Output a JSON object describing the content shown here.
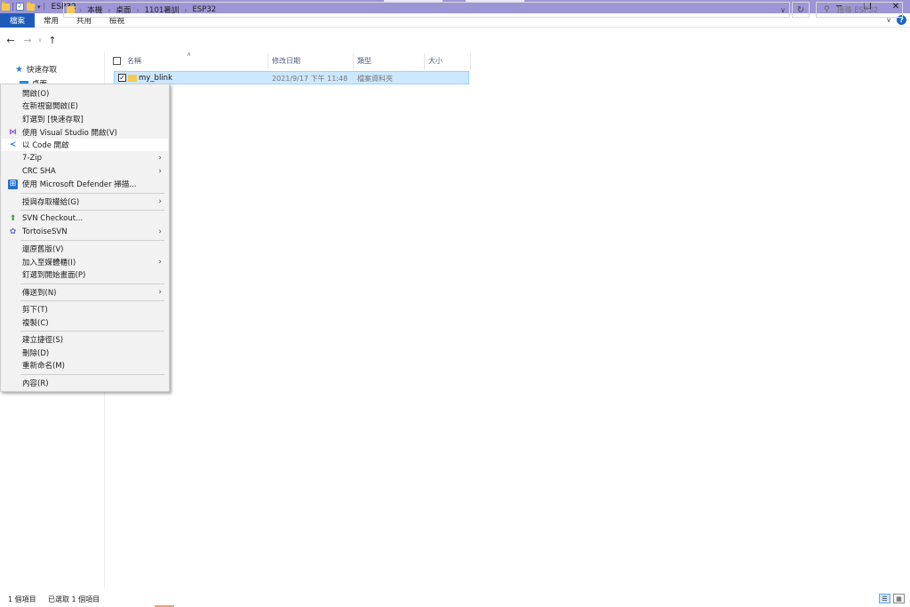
{
  "window": {
    "title": "ESP32",
    "controls": {
      "minimize": "─",
      "maximize": "❐",
      "close": "✕"
    }
  },
  "ribbon": {
    "tabs": [
      "檔案",
      "常用",
      "共用",
      "檢視"
    ],
    "collapse_icon": "chevron-down-icon",
    "help": "?"
  },
  "address": {
    "breadcrumb": [
      "本機",
      "桌面",
      "1101暑訓",
      "ESP32"
    ],
    "search_placeholder": "搜尋 ESP32"
  },
  "nav_pane": {
    "quick_access": "快速存取",
    "desktop": "桌面"
  },
  "columns": [
    "名稱",
    "修改日期",
    "類型",
    "大小"
  ],
  "files": [
    {
      "name": "my_blink",
      "modified": "2021/9/17 下午 11:48",
      "type": "檔案資料夾",
      "size": "",
      "selected": true
    }
  ],
  "context_menu": {
    "items": [
      {
        "label": "開啟(O)"
      },
      {
        "label": "在新視窗開啟(E)"
      },
      {
        "label": "釘選到 [快速存取]"
      },
      {
        "label": "使用 Visual Studio 開啟(V)",
        "icon": "visual-studio-icon"
      },
      {
        "label": "以 Code 開啟",
        "icon": "vscode-icon",
        "highlighted": true
      },
      {
        "label": "7-Zip",
        "submenu": true
      },
      {
        "label": "CRC SHA",
        "submenu": true
      },
      {
        "label": "使用 Microsoft Defender 掃描...",
        "icon": "defender-icon"
      },
      {
        "label": "授與存取權給(G)",
        "submenu": true
      },
      {
        "label": "SVN Checkout...",
        "icon": "svn-checkout-icon"
      },
      {
        "label": "TortoiseSVN",
        "icon": "tortoisesvn-icon",
        "submenu": true
      },
      {
        "label": "還原舊版(V)"
      },
      {
        "label": "加入至媒體櫃(I)",
        "submenu": true
      },
      {
        "label": "釘選到開始畫面(P)"
      },
      {
        "label": "傳送到(N)",
        "submenu": true
      },
      {
        "label": "剪下(T)"
      },
      {
        "label": "複製(C)"
      },
      {
        "label": "建立捷徑(S)"
      },
      {
        "label": "刪除(D)"
      },
      {
        "label": "重新命名(M)"
      },
      {
        "label": "內容(R)"
      }
    ]
  },
  "status": {
    "item_count": "1 個項目",
    "selected": "已選取 1 個項目"
  },
  "colors": {
    "titlebar": "#9c96d6",
    "ribbon_active": "#1e5bb8",
    "selection": "#cce8ff"
  }
}
